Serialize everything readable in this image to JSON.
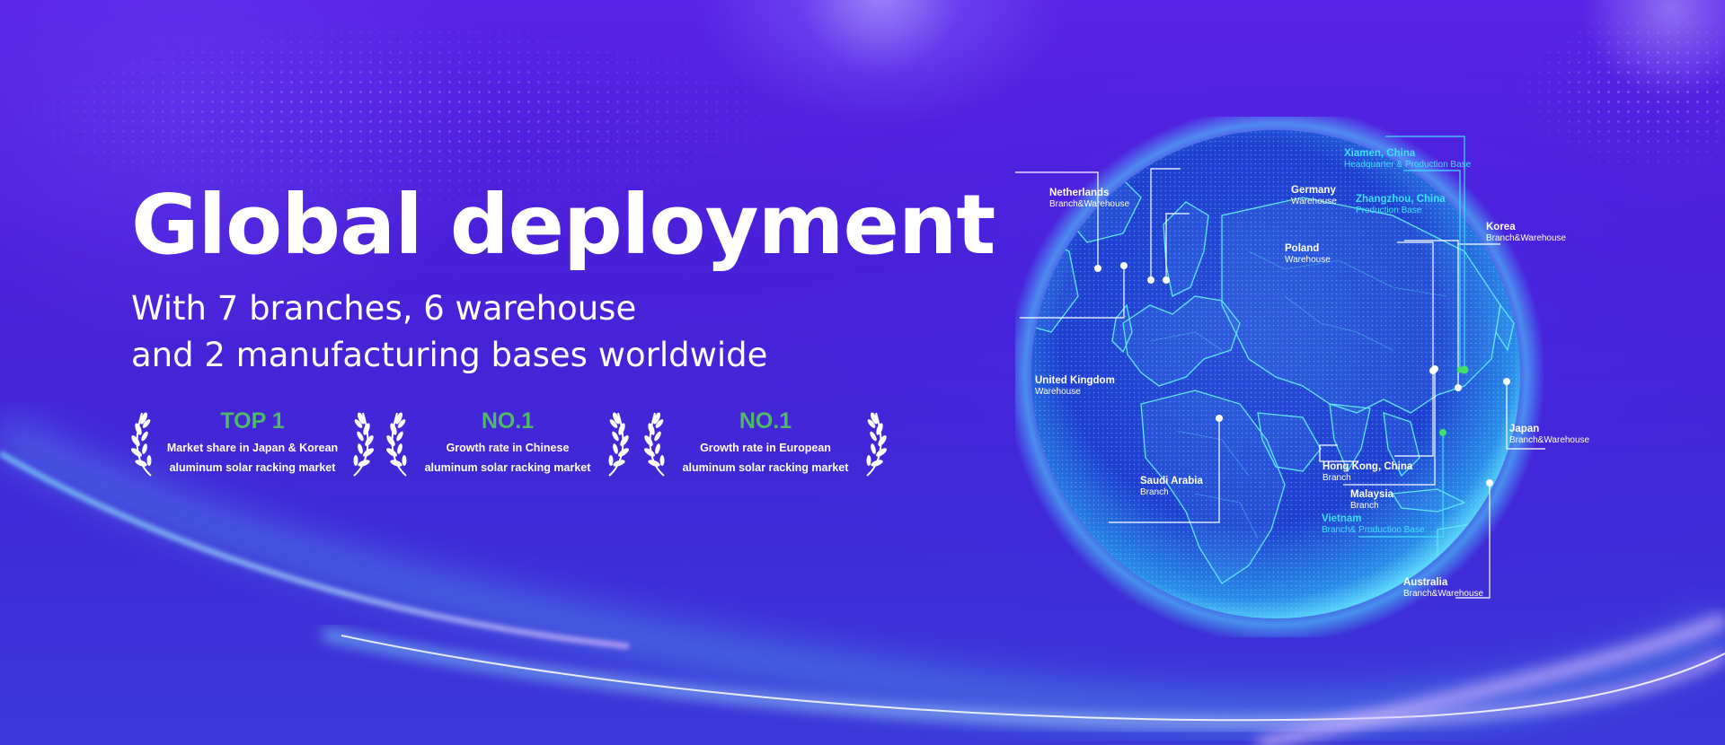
{
  "headline": "Global deployment",
  "subheading": {
    "line1": "With 7 branches, 6 warehouse",
    "line2": "and 2 manufacturing bases worldwide"
  },
  "awards": [
    {
      "rank": "TOP 1",
      "line1": "Market share in Japan & Korean",
      "line2": "aluminum solar racking market"
    },
    {
      "rank": "NO.1",
      "line1": "Growth rate in Chinese",
      "line2": "aluminum solar racking market"
    },
    {
      "rank": "NO.1",
      "line1": "Growth rate in European",
      "line2": "aluminum solar racking market"
    }
  ],
  "locations": [
    {
      "name": "Netherlands",
      "role": "Branch&Warehouse"
    },
    {
      "name": "Germany",
      "role": "Warehouse"
    },
    {
      "name": "Poland",
      "role": "Warehouse"
    },
    {
      "name": "United Kingdom",
      "role": "Warehouse"
    },
    {
      "name": "Saudi Arabia",
      "role": "Branch"
    },
    {
      "name": "Xiamen, China",
      "role": "Headquarter & Production Base"
    },
    {
      "name": "Zhangzhou, China",
      "role": "Production Base"
    },
    {
      "name": "Korea",
      "role": "Branch&Warehouse"
    },
    {
      "name": "Japan",
      "role": "Branch&Warehouse"
    },
    {
      "name": "Hong Kong, China",
      "role": "Branch"
    },
    {
      "name": "Malaysia",
      "role": "Branch"
    },
    {
      "name": "Vietnam",
      "role": "Branch& Production Base"
    },
    {
      "name": "Australia",
      "role": "Branch&Warehouse"
    }
  ],
  "colors": {
    "background": "#4a1fd8",
    "award_rank": "#4fb86a",
    "globe_cyan": "#3fe0ff",
    "text": "#ffffff"
  },
  "icons": [
    "laurel-wreath-icon",
    "location-dot-icon"
  ]
}
